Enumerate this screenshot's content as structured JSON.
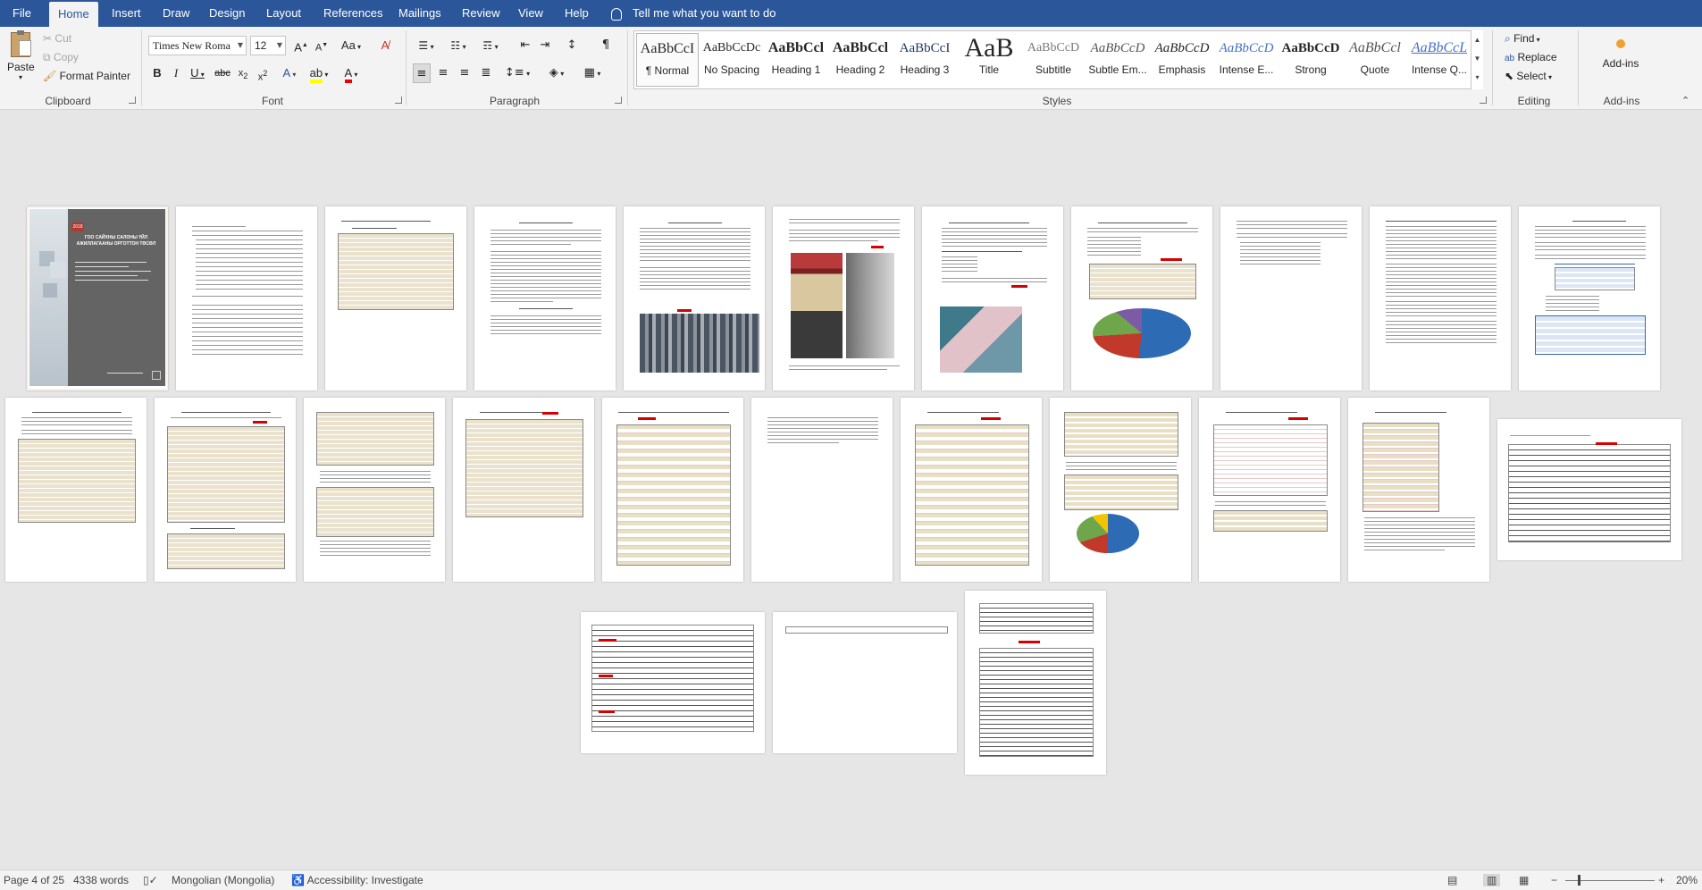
{
  "menu": {
    "tabs": [
      "File",
      "Home",
      "Insert",
      "Draw",
      "Design",
      "Layout",
      "References",
      "Mailings",
      "Review",
      "View",
      "Help"
    ],
    "active": "Home",
    "tell_me": "Tell me what you want to do"
  },
  "clipboard": {
    "paste": "Paste",
    "cut": "Cut",
    "copy": "Copy",
    "format_painter": "Format Painter",
    "label": "Clipboard"
  },
  "font": {
    "name": "Times New Roma",
    "size": "12",
    "case_btn": "Aa",
    "label": "Font"
  },
  "paragraph": {
    "label": "Paragraph"
  },
  "styles": {
    "items": [
      {
        "preview": "AaBbCcI",
        "name": "¶ Normal"
      },
      {
        "preview": "AaBbCcDc",
        "name": "No Spacing"
      },
      {
        "preview": "AaBbCcl",
        "name": "Heading 1"
      },
      {
        "preview": "AaBbCcl",
        "name": "Heading 2"
      },
      {
        "preview": "AaBbCcI",
        "name": "Heading 3"
      },
      {
        "preview": "AaB",
        "name": "Title"
      },
      {
        "preview": "AaBbCcD",
        "name": "Subtitle"
      },
      {
        "preview": "AaBbCcD",
        "name": "Subtle Em..."
      },
      {
        "preview": "AaBbCcD",
        "name": "Emphasis"
      },
      {
        "preview": "AaBbCcD",
        "name": "Intense E..."
      },
      {
        "preview": "AaBbCcD",
        "name": "Strong"
      },
      {
        "preview": "AaBbCcl",
        "name": "Quote"
      },
      {
        "preview": "AaBbCcL",
        "name": "Intense Q..."
      }
    ],
    "label": "Styles"
  },
  "editing": {
    "find": "Find",
    "replace": "Replace",
    "select": "Select",
    "label": "Editing"
  },
  "addins": {
    "button": "Add-ins",
    "label": "Add-ins"
  },
  "cover": {
    "year": "2018",
    "title": "ГОО САЙХНЫ САЛОНЫ ҮЙЛ АЖИЛЛАГААНЫ ОРГОТТОН ТӨСӨЛ"
  },
  "status": {
    "page": "Page 4 of 25",
    "words": "4338 words",
    "language": "Mongolian (Mongolia)",
    "accessibility": "Accessibility: Investigate",
    "zoom": "20%"
  },
  "colors": {
    "title_bar": "#2b579a",
    "ribbon": "#f3f3f3",
    "canvas": "#e6e6e6",
    "table_tan": "#eae2cc",
    "accent_red": "#d60000"
  }
}
